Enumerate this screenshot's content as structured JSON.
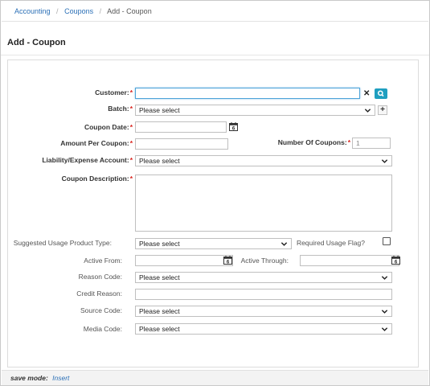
{
  "breadcrumb": {
    "items": [
      "Accounting",
      "Coupons",
      "Add - Coupon"
    ],
    "separator": "/"
  },
  "page": {
    "title": "Add - Coupon"
  },
  "form": {
    "customer": {
      "label": "Customer:",
      "value": ""
    },
    "batch": {
      "label": "Batch:",
      "value": "Please select"
    },
    "coupon_date": {
      "label": "Coupon Date:",
      "value": ""
    },
    "amount_per_coupon": {
      "label": "Amount Per Coupon:",
      "value": ""
    },
    "number_of_coupons": {
      "label": "Number Of Coupons:",
      "value": "1"
    },
    "liability_account": {
      "label": "Liability/Expense Account:",
      "value": "Please select"
    },
    "coupon_description": {
      "label": "Coupon Description:",
      "value": ""
    },
    "suggested_product_type": {
      "label": "Suggested Usage Product Type:",
      "value": "Please select"
    },
    "required_usage_flag": {
      "label": "Required Usage Flag?",
      "checked": false
    },
    "active_from": {
      "label": "Active From:",
      "value": ""
    },
    "active_through": {
      "label": "Active Through:",
      "value": ""
    },
    "reason_code": {
      "label": "Reason Code:",
      "value": "Please select"
    },
    "credit_reason": {
      "label": "Credit Reason:",
      "value": ""
    },
    "source_code": {
      "label": "Source Code:",
      "value": "Please select"
    },
    "media_code": {
      "label": "Media Code:",
      "value": "Please select"
    },
    "required_marker": "*",
    "calendar_day": "6"
  },
  "footer": {
    "save_mode_label": "save mode:",
    "save_mode_value": "Insert"
  },
  "colors": {
    "link": "#2a6fb6",
    "required": "#d9231d",
    "search_button": "#1f9fc0",
    "focus_border": "#4da3d8"
  },
  "icons": [
    "clear-icon",
    "search-icon",
    "plus-icon",
    "chevron-down-icon",
    "calendar-icon"
  ]
}
